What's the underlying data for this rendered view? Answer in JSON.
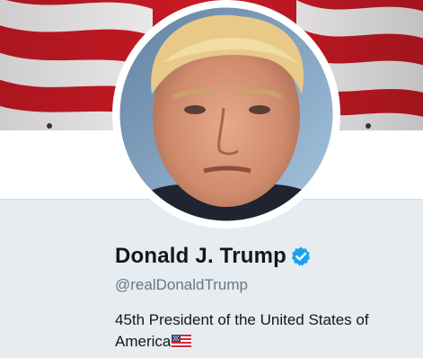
{
  "profile": {
    "name": "Donald J. Trump",
    "handle": "@realDonaldTrump",
    "bio": "45th President of the United States of America",
    "verified": true
  },
  "icons": {
    "verified": "verified-badge-icon",
    "bio_emoji": "us-flag-emoji-icon"
  },
  "colors": {
    "name_text": "#14171a",
    "handle_text": "#657786",
    "verified_blue": "#1da1f2",
    "background": "#e6ecf0",
    "banner_red": "#c91a24"
  }
}
